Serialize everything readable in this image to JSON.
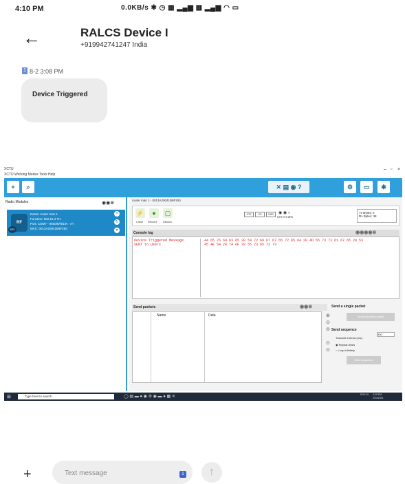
{
  "status_bar": {
    "time": "4:10 PM",
    "icons": "0.0KB/s ✱ ◷ ▦ ▂▄▆ ▦ ▂▄▆ ◠ ▭"
  },
  "header": {
    "contact": "RALCS Device I",
    "phone": "+919942741247 India"
  },
  "message": {
    "sim": "1",
    "time": "8-2 3:08 PM",
    "text": "Device Triggered"
  },
  "screenshot": {
    "title": "XCTU",
    "menu": "XCTU   Working Modes   Tools   Help",
    "radio_modules": "Radio Modules",
    "device": {
      "name": "Name: router man 1",
      "function": "Function: 802.15.4 TH",
      "port": "Port: COM7 - 9600/8/N/1/N - AT",
      "mac": "MAC: 0013A20041B9F250",
      "badge": "802"
    },
    "tab": "router man 1 - 0013A20041B9F250",
    "actions": [
      "Close",
      "Record",
      "Detach"
    ],
    "signals": [
      "CTS",
      "CD",
      "DSR"
    ],
    "signal_labels": "DTR  RTS  BRK",
    "tx": "Tx Bytes: 0",
    "rx": "Rx Bytes: 38",
    "console_title": "Console log",
    "console_ascii": [
      "Device Triggered Message",
      "SENT to Users"
    ],
    "console_hex": [
      "44 65 76 69 63 65 20 54 72 69 67 67 65 72 65 64 20 4D 65 73 73 61 67 65 20 53",
      "45 4E 54 20 74 6F 20 55 73 65 72 73"
    ],
    "send_packets": "Send packets",
    "cols": [
      "Name",
      "Data"
    ],
    "single": "Send a single packet",
    "send_selected": "Send selected packet",
    "sequence": "Send sequence",
    "interval": "Transmit interval (ms):",
    "interval_val": "500",
    "repeat": "Repeat times",
    "loop": "Loop infinitely",
    "start": "Start sequence",
    "taskbar_search": "Type here to search",
    "taskbar_time": "3:29 PM",
    "taskbar_date": "2/24/2021",
    "taskbar_lang": "ENG IN"
  },
  "compose": {
    "placeholder": "Text message",
    "sim": "1"
  }
}
